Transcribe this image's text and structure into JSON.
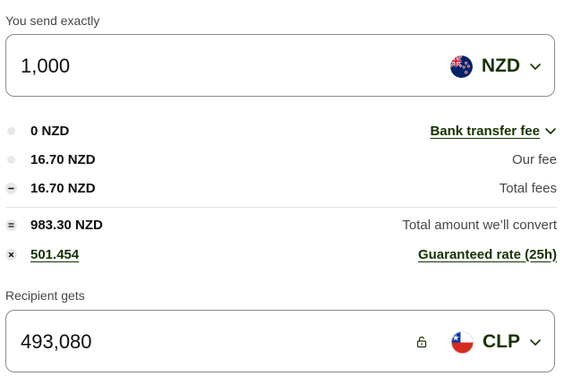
{
  "send": {
    "label": "You send exactly",
    "amount": "1,000",
    "currency": "NZD",
    "flag_icon": "new-zealand-flag-icon"
  },
  "fees": [
    {
      "amount": "0 NZD",
      "description": "Bank transfer fee",
      "bullet": "dot",
      "is_link": true
    },
    {
      "amount": "16.70 NZD",
      "description": "Our fee",
      "bullet": "dot",
      "is_link": false
    },
    {
      "amount": "16.70 NZD",
      "description": "Total fees",
      "bullet": "minus",
      "is_link": false
    }
  ],
  "conversion": {
    "amount": "983.30 NZD",
    "description": "Total amount we’ll convert"
  },
  "rate": {
    "value": "501.454",
    "description": "Guaranteed rate (25h)"
  },
  "receive": {
    "label": "Recipient gets",
    "amount": "493,080",
    "currency": "CLP",
    "flag_icon": "chile-flag-icon"
  },
  "colors": {
    "brand_green": "#163300",
    "border": "#8a8c88",
    "muted_text": "#454745"
  }
}
